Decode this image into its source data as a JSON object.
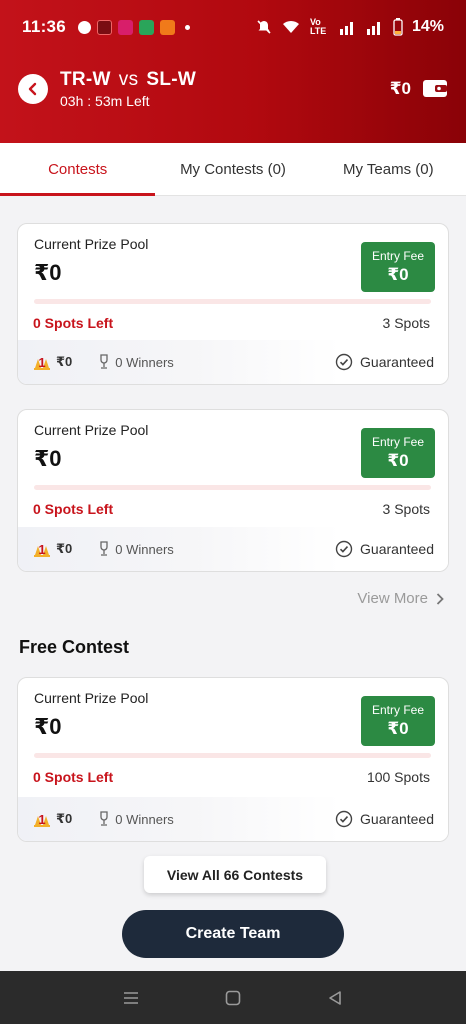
{
  "status_bar": {
    "time": "11:36",
    "network_label": "Vo LTE",
    "battery": "14%"
  },
  "header": {
    "team_a": "TR-W",
    "vs": "vs",
    "team_b": "SL-W",
    "time_left": "03h : 53m Left",
    "balance": "₹0"
  },
  "tabs": [
    {
      "label": "Contests",
      "active": true
    },
    {
      "label": "My Contests (0)",
      "active": false
    },
    {
      "label": "My Teams (0)",
      "active": false
    }
  ],
  "contests": [
    {
      "pool_label": "Current Prize Pool",
      "pool_value": "₹0",
      "entry_label": "Entry Fee",
      "entry_value": "₹0",
      "fill_fraction": 0,
      "spots_left": "0 Spots Left",
      "spots_total": "3 Spots",
      "first_prize": "₹0",
      "winners": "0 Winners",
      "guaranteed": "Guaranteed"
    },
    {
      "pool_label": "Current Prize Pool",
      "pool_value": "₹0",
      "entry_label": "Entry Fee",
      "entry_value": "₹0",
      "fill_fraction": 0,
      "spots_left": "0 Spots Left",
      "spots_total": "3 Spots",
      "first_prize": "₹0",
      "winners": "0 Winners",
      "guaranteed": "Guaranteed"
    }
  ],
  "view_more": "View More",
  "free_section": {
    "title": "Free Contest",
    "contest": {
      "pool_label": "Current Prize Pool",
      "pool_value": "₹0",
      "entry_label": "Entry Fee",
      "entry_value": "₹0",
      "fill_fraction": 0,
      "spots_left": "0 Spots Left",
      "spots_total": "100 Spots",
      "first_prize": "₹0",
      "winners": "0 Winners",
      "guaranteed": "Guaranteed"
    }
  },
  "view_all": "View All 66 Contests",
  "create_team": "Create Team",
  "colors": {
    "brand_red": "#c8141c",
    "entry_green": "#2c8a43",
    "button_dark": "#1e2a3b"
  },
  "icons": [
    "back-arrow-icon",
    "wallet-icon",
    "first-rank-icon",
    "trophy-icon",
    "check-circle-icon",
    "chevron-right-icon",
    "menu-nav-icon",
    "home-nav-icon",
    "back-nav-icon"
  ]
}
